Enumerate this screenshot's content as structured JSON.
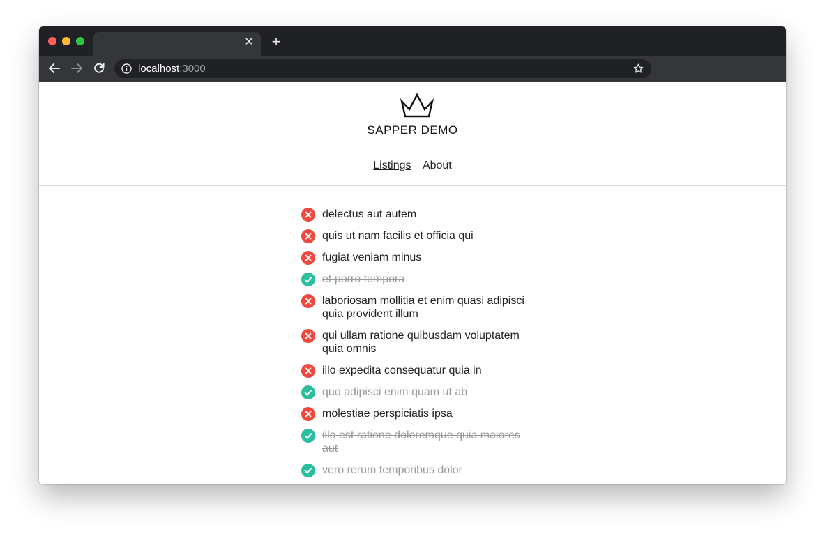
{
  "browser": {
    "url_host": "localhost",
    "url_port": ":3000",
    "colors": {
      "chrome_dark": "#202124",
      "chrome_toolbar": "#35363a"
    }
  },
  "site": {
    "title": "SAPPER DEMO",
    "nav": [
      {
        "label": "Listings",
        "active": true
      },
      {
        "label": "About",
        "active": false
      }
    ]
  },
  "todos": [
    {
      "text": "delectus aut autem",
      "completed": false
    },
    {
      "text": "quis ut nam facilis et officia qui",
      "completed": false
    },
    {
      "text": "fugiat veniam minus",
      "completed": false
    },
    {
      "text": "et porro tempora",
      "completed": true
    },
    {
      "text": "laboriosam mollitia et enim quasi adipisci quia provident illum",
      "completed": false
    },
    {
      "text": "qui ullam ratione quibusdam voluptatem quia omnis",
      "completed": false
    },
    {
      "text": "illo expedita consequatur quia in",
      "completed": false
    },
    {
      "text": "quo adipisci enim quam ut ab",
      "completed": true
    },
    {
      "text": "molestiae perspiciatis ipsa",
      "completed": false
    },
    {
      "text": "illo est ratione doloremque quia maiores aut",
      "completed": true
    },
    {
      "text": "vero rerum temporibus dolor",
      "completed": true
    }
  ],
  "colors": {
    "incomplete": "#f0483e",
    "complete": "#2bbf9f"
  }
}
